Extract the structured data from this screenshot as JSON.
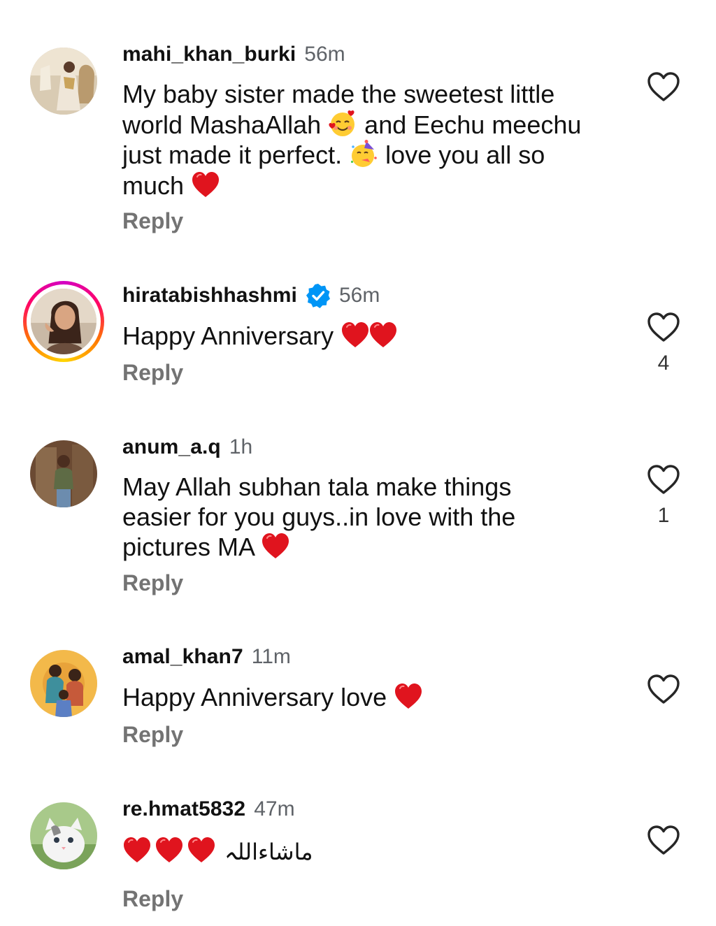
{
  "comments": [
    {
      "username": "mahi_khan_burki",
      "time": "56m",
      "lines": [
        "My baby sister made the sweetest little",
        "world MashaAllah",
        "and Eechu meechu",
        "just made it perfect.",
        "love you all so",
        "much"
      ],
      "reply": "Reply",
      "likes": ""
    },
    {
      "username": "hiratabishhashmi",
      "time": "56m",
      "text": "Happy Anniversary",
      "reply": "Reply",
      "likes": "4"
    },
    {
      "username": "anum_a.q",
      "time": "1h",
      "lines": [
        "May Allah subhan tala make things",
        "easier for you guys..in love with the",
        "pictures MA"
      ],
      "reply": "Reply",
      "likes": "1"
    },
    {
      "username": "amal_khan7",
      "time": "11m",
      "text": "Happy Anniversary love",
      "reply": "Reply",
      "likes": ""
    },
    {
      "username": "re.hmat5832",
      "time": "47m",
      "text": "ماشاءاللہ",
      "reply": "Reply",
      "likes": ""
    }
  ],
  "icons": {
    "like": "heart-outline-icon",
    "verified": "verified-badge-icon",
    "heart_emoji": "red-heart-emoji",
    "smiling_hearts": "smiling-face-with-hearts-emoji",
    "party_face": "partying-face-emoji"
  },
  "colors": {
    "username": "#111111",
    "meta": "#5f6368",
    "reply": "#737373",
    "verified": "#0095f6",
    "heart": "#e0141e"
  }
}
